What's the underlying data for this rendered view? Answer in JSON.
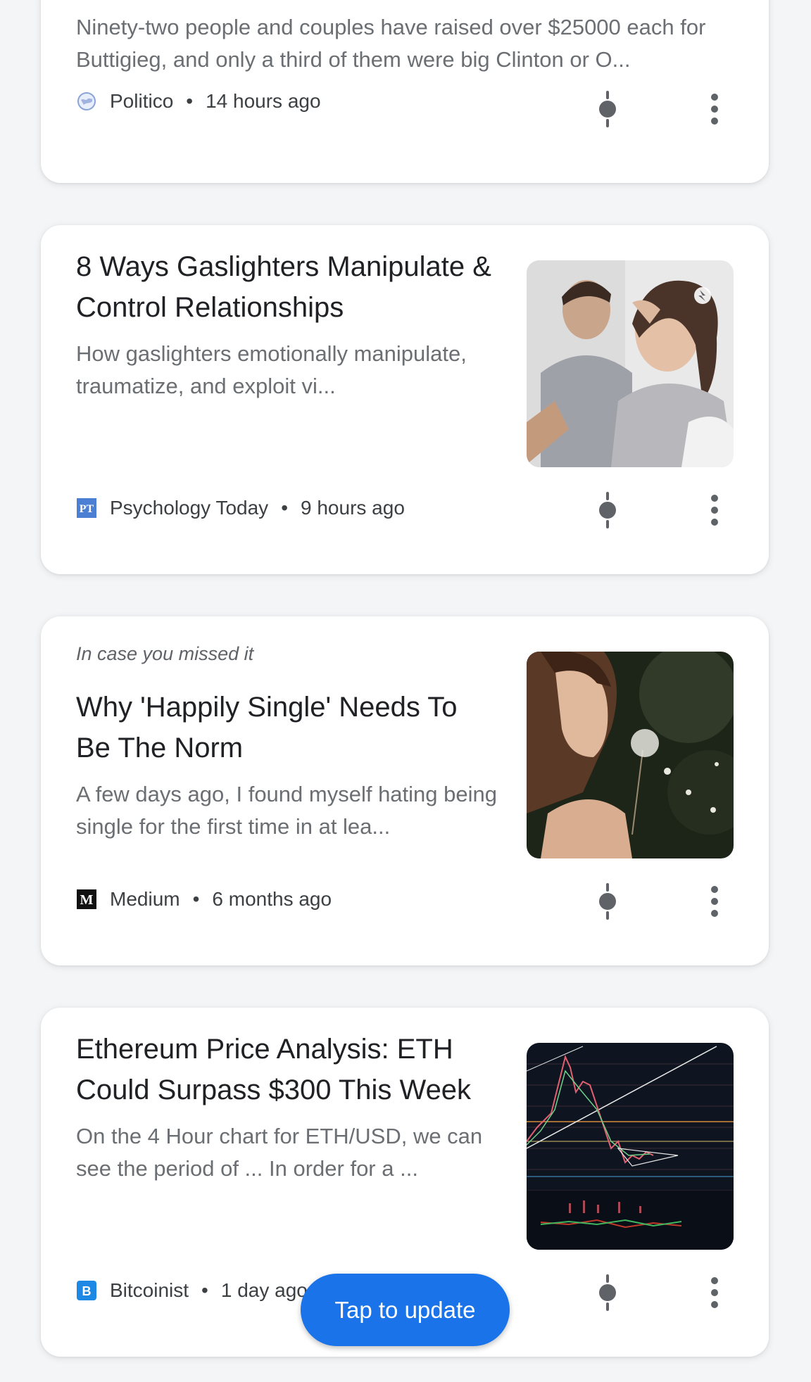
{
  "colors": {
    "accent": "#1a73e8",
    "title_text": "#202124",
    "snippet_text": "#6b6f73",
    "meta_text": "#3c4043",
    "icon_gray": "#5f6368"
  },
  "cards": [
    {
      "snippet": "Ninety-two people and couples have raised over $25000 each for Buttigieg, and only a third of them were big Clinton or O...",
      "source": "Politico",
      "time": "14 hours ago",
      "source_icon": "globe-icon"
    },
    {
      "title": "8 Ways Gaslighters Manipulate & Control Relationships",
      "snippet": "How gaslighters emotionally manipulate, traumatize, and exploit vi...",
      "source": "Psychology Today",
      "time": "9 hours ago",
      "logo_text": "PT",
      "source_icon": "psychology-today-logo"
    },
    {
      "kicker": "In case you missed it",
      "title": "Why 'Happily Single' Needs To Be The Norm",
      "snippet": "A few days ago, I found myself hating being single for the first time in at lea...",
      "source": "Medium",
      "time": "6 months ago",
      "logo_text": "M",
      "source_icon": "medium-logo"
    },
    {
      "title": "Ethereum Price Analysis: ETH Could Surpass $300 This Week",
      "snippet": "On the 4 Hour chart for ETH/USD, we can see the period of ... In order for a ...",
      "source": "Bitcoinist",
      "time": "1 day ago",
      "logo_text": "B",
      "source_icon": "bitcoinist-logo"
    }
  ],
  "separator": "•",
  "update_button": "Tap to update"
}
